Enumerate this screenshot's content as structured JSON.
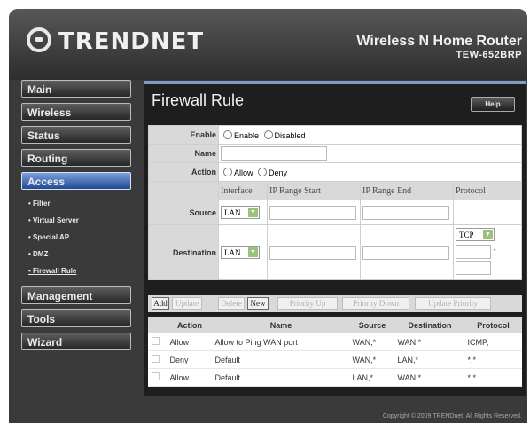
{
  "brand": {
    "logo_text": "TRENDNET",
    "product_name": "Wireless N Home Router",
    "model": "TEW-652BRP"
  },
  "sidebar": {
    "items": [
      {
        "label": "Main"
      },
      {
        "label": "Wireless"
      },
      {
        "label": "Status"
      },
      {
        "label": "Routing"
      },
      {
        "label": "Access"
      },
      {
        "label": "Management"
      },
      {
        "label": "Tools"
      },
      {
        "label": "Wizard"
      }
    ],
    "access_subitems": [
      "Filter",
      "Virtual Server",
      "Special AP",
      "DMZ",
      "Firewall Rule"
    ]
  },
  "page": {
    "title": "Firewall Rule",
    "help_label": "Help"
  },
  "form": {
    "enable_label": "Enable",
    "enable_option": "Enable",
    "disabled_option": "Disabled",
    "name_label": "Name",
    "name_value": "",
    "action_label": "Action",
    "allow_option": "Allow",
    "deny_option": "Deny",
    "columns": {
      "interface": "Interface",
      "ip_start": "IP Range Start",
      "ip_end": "IP Range End",
      "protocol": "Protocol"
    },
    "source_label": "Source",
    "source_interface": "LAN",
    "destination_label": "Destination",
    "destination_interface": "LAN",
    "protocol_value": "TCP",
    "port_separator": "-"
  },
  "buttons": {
    "add": "Add",
    "update": "Update",
    "delete": "Delete",
    "new": "New",
    "priority_up": "Priority Up",
    "priority_down": "Priority Down",
    "update_priority": "Update Priority"
  },
  "rules_table": {
    "headers": [
      "Action",
      "Name",
      "Source",
      "Destination",
      "Protocol"
    ],
    "rows": [
      {
        "action": "Allow",
        "name": "Allow to Ping WAN port",
        "source": "WAN,*",
        "destination": "WAN,*",
        "protocol": "ICMP,"
      },
      {
        "action": "Deny",
        "name": "Default",
        "source": "WAN,*",
        "destination": "LAN,*",
        "protocol": "*,*"
      },
      {
        "action": "Allow",
        "name": "Default",
        "source": "LAN,*",
        "destination": "WAN,*",
        "protocol": "*,*"
      }
    ]
  },
  "footer": {
    "copyright": "Copyright © 2009 TRENDnet. All Rights Reserved."
  },
  "colors": {
    "active_nav": "#2c5aa8",
    "frame": "#333333",
    "content_bg": "#1e1e1e"
  }
}
